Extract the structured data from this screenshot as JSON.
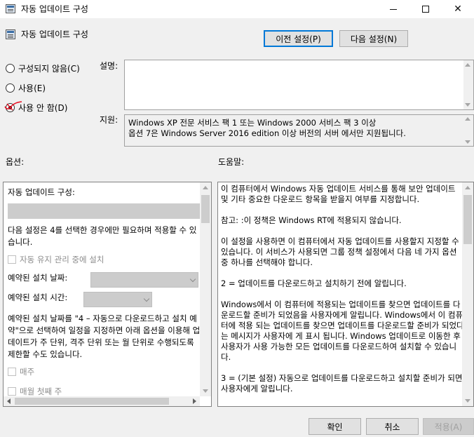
{
  "window": {
    "title": "자동 업데이트 구성",
    "minimize_icon": "minimize-icon",
    "maximize_icon": "maximize-icon",
    "close_symbol": "✕"
  },
  "header": {
    "title": "자동 업데이트 구성",
    "prev_button": "이전 설정(P)",
    "next_button": "다음 설정(N)"
  },
  "state": {
    "options": [
      {
        "label": "구성되지 않음(C)",
        "checked": false
      },
      {
        "label": "사용(E)",
        "checked": false
      },
      {
        "label": "사용 안 함(D)",
        "checked": true
      }
    ]
  },
  "labels": {
    "description": "설명:",
    "supported": "지원:",
    "options": "옵션:",
    "help": "도움말:"
  },
  "supported_text": [
    "Windows XP 전문 서비스 팩 1 또는 Windows 2000 서비스 팩 3 이상",
    "옵션 7은 Windows Server 2016 edition 이상 버전의 서버 에서만 지원됩니다."
  ],
  "options_panel": {
    "title": "자동 업데이트 구성:",
    "note": "다음 설정은 4를 선택한 경우에만 필요하며 적용할 수 있습니다.",
    "install_during_maintenance": "자동 유지 관리 중에 설치",
    "scheduled_day_label": "예약된 설치 날짜:",
    "scheduled_time_label": "예약된 설치 시간:",
    "note2": "예약된 설치 날짜를 \"4 – 자동으로 다운로드하고 설치 예약\"으로 선택하여 일정을 지정하면 아래 옵션을 이용해 업데이트가 주 단위, 격주 단위 또는 월 단위로 수행되도록 제한할 수도 있습니다.",
    "weekly": "매주",
    "first_week": "매월 첫째 주"
  },
  "help_text": [
    "이 컴퓨터에서 Windows 자동 업데이트 서비스를 통해 보안 업데이트 및 기타 중요한 다운로드 항목을 받을지 여부를 지정합니다.",
    "참고: :이 정책은 Windows RT에 적용되지 않습니다.",
    "이 설정을 사용하면 이 컴퓨터에서 자동 업데이트를 사용할지 지정할 수 있습니다. 이 서비스가 사용되면 그룹 정책 설정에서 다음 네 가지 옵션 중 하나를 선택해야 합니다.",
    " 2 = 업데이트를 다운로드하고 설치하기 전에 알립니다.",
    " Windows에서 이 컴퓨터에 적용되는 업데이트를 찾으면 업데이트를 다운로드할 준비가 되었음을 사용자에게 알립니다. Windows에서 이 컴퓨터에 적용 되는 업데이트를 찾으면 업데이트를 다운로드할 준비가 되었다는 메시지가 사용자에 게 표시 됩니다. Windows 업데이트로 이동한 후 사용자가 사용 가능한 모든 업데이트를 다운로드하여 설치할 수 있습니다.",
    " 3 = (기본 설정) 자동으로 업데이트를 다운로드하고 설치할 준비가 되면 사용자에게 알립니다."
  ],
  "buttons": {
    "ok": "확인",
    "cancel": "취소",
    "apply": "적용(A)"
  },
  "colors": {
    "accent": "#0078d7",
    "disabled_field": "#cccccc",
    "annotation_mark": "#e81123"
  }
}
